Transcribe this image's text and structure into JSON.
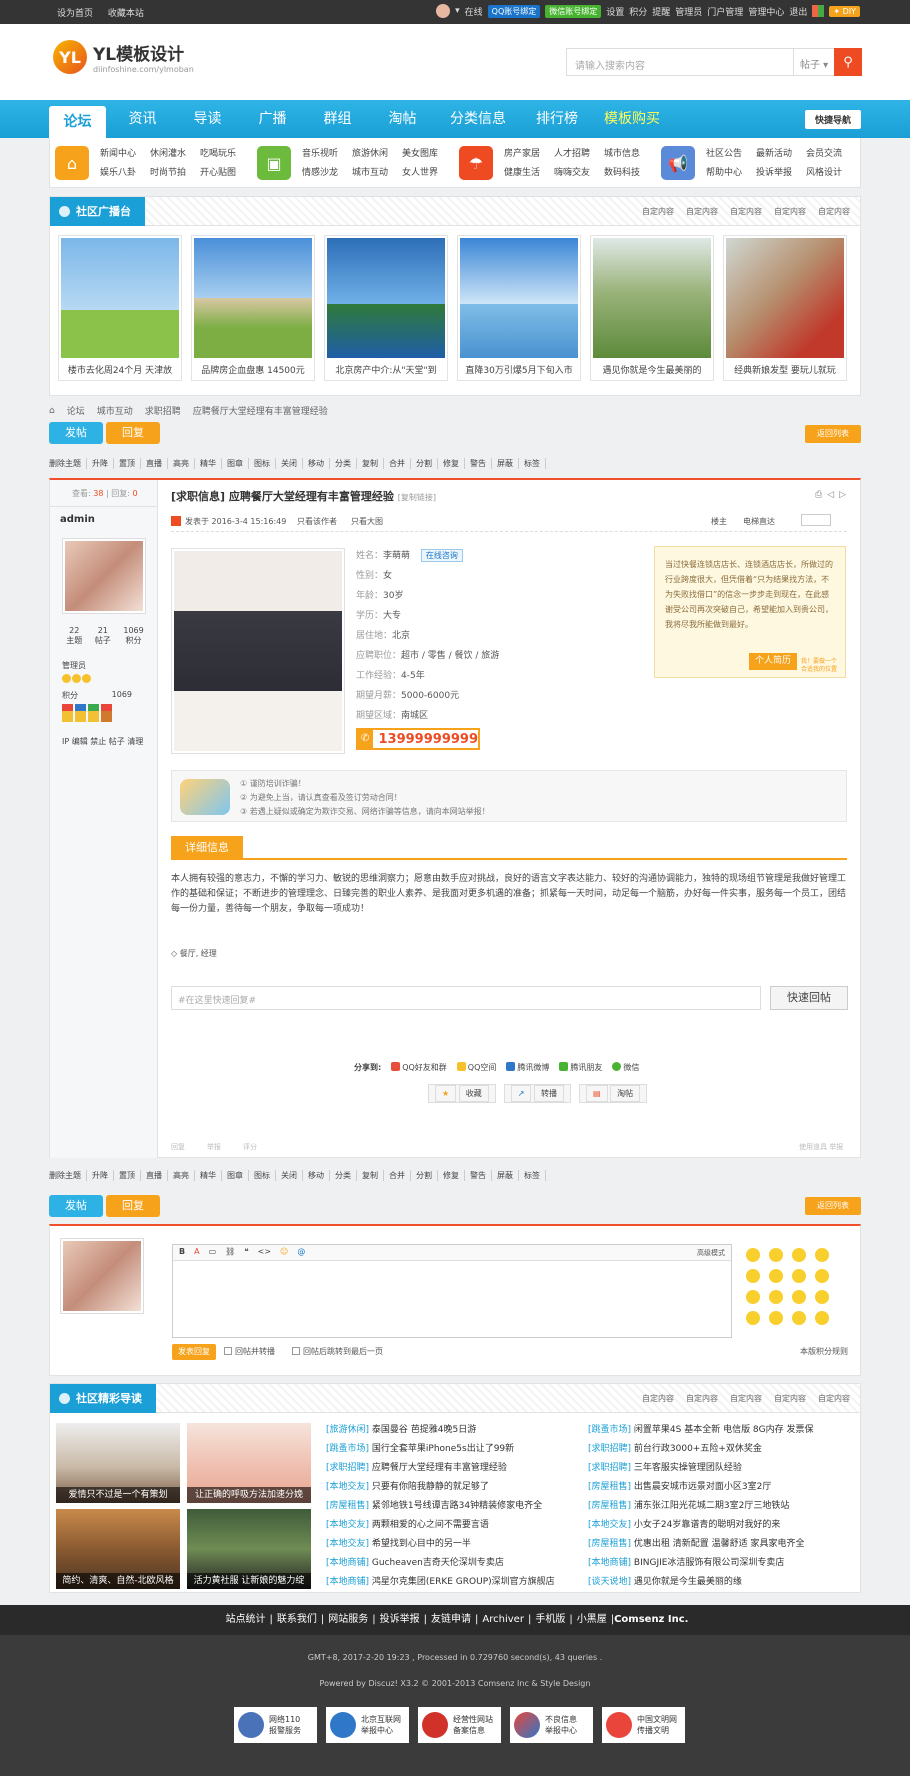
{
  "topbar": {
    "left": [
      "设为首页",
      "收藏本站"
    ],
    "online": "在线",
    "qq_bind": "QQ账号绑定",
    "wx_bind": "微信账号绑定",
    "right_links": [
      "设置",
      "积分",
      "提醒",
      "管理员",
      "门户管理",
      "管理中心",
      "退出"
    ],
    "diy": "DIY"
  },
  "header": {
    "logo_main": "YL模板设计",
    "logo_sub": "diinfoshine.com/ylmoban",
    "search_placeholder": "请输入搜索内容",
    "search_type": "帖子"
  },
  "nav": {
    "items": [
      "论坛",
      "资讯",
      "导读",
      "广播",
      "群组",
      "淘帖",
      "分类信息",
      "排行榜",
      "模板购买"
    ],
    "quick": "快捷导航"
  },
  "cats": [
    {
      "links": [
        "新闻中心",
        "休闲灌水",
        "吃喝玩乐",
        "娱乐八卦",
        "时尚节拍",
        "开心贴图"
      ],
      "color": "#f7a21b",
      "icon": "home-icon"
    },
    {
      "links": [
        "音乐视听",
        "旅游休闲",
        "美女图库",
        "情感沙龙",
        "城市互动",
        "女人世界"
      ],
      "color": "#6dbb3c",
      "icon": "picture-icon"
    },
    {
      "links": [
        "房产家居",
        "人才招聘",
        "城市信息",
        "健康生活",
        "嗨嗨交友",
        "数码科技"
      ],
      "color": "#ee4b23",
      "icon": "umbrella-icon"
    },
    {
      "links": [
        "社区公告",
        "最新活动",
        "会员交流",
        "帮助中心",
        "投诉举报",
        "风格设计"
      ],
      "color": "#5b8bd8",
      "icon": "megaphone-icon"
    }
  ],
  "broadcast": {
    "title": "社区广播台",
    "links": [
      "自定内容",
      "自定内容",
      "自定内容",
      "自定内容",
      "自定内容"
    ],
    "items": [
      "楼市去化周24个月 天津放",
      "品牌房企血盘惠 14500元",
      "北京房产中介:从\"天堂\"到",
      "直降30万引爆5月下旬入市",
      "遇见你就是今生最美丽的",
      "经典新娘发型 要玩儿就玩"
    ]
  },
  "crumb": [
    "论坛",
    "城市互动",
    "求职招聘",
    "应聘餐厅大堂经理有丰富管理经验"
  ],
  "buttons": {
    "post": "发帖",
    "reply": "回复",
    "back": "返回列表"
  },
  "modbar": [
    "删除主题",
    "升降",
    "置顶",
    "直播",
    "高亮",
    "精华",
    "图章",
    "图标",
    "关闭",
    "移动",
    "分类",
    "复制",
    "合并",
    "分割",
    "修复",
    "警告",
    "屏蔽",
    "标签"
  ],
  "post": {
    "views_label": "查看:",
    "views": "38",
    "replies_label": "回复:",
    "replies": "0",
    "author": "admin",
    "stats": [
      {
        "n": "22",
        "l": "主题"
      },
      {
        "n": "21",
        "l": "帖子"
      },
      {
        "n": "1069",
        "l": "积分"
      }
    ],
    "group": "管理员",
    "points_label": "积分",
    "points": "1069",
    "admin_links": "IP 编辑 禁止 帖子 清理",
    "title": "[求职信息] 应聘餐厅大堂经理有丰富管理经验",
    "copy": "[复制链接]",
    "meta": "发表于 2016-3-4 15:16:49",
    "only_author": "只看该作者",
    "big_img": "只看大图",
    "floor": "楼主",
    "ebook": "电梯直达",
    "fields": [
      {
        "k": "姓名：",
        "v": "李萌萌"
      },
      {
        "k": "性别：",
        "v": "女"
      },
      {
        "k": "年龄：",
        "v": "30岁"
      },
      {
        "k": "学历：",
        "v": "大专"
      },
      {
        "k": "居住地：",
        "v": "北京"
      },
      {
        "k": "应聘职位：",
        "v": "超市 / 零售 / 餐饮 / 旅游"
      },
      {
        "k": "工作经验：",
        "v": "4-5年"
      },
      {
        "k": "期望月薪：",
        "v": "5000-6000元"
      },
      {
        "k": "期望区域：",
        "v": "南城区"
      }
    ],
    "consult": "在线咨询",
    "phone": "13999999999",
    "note": "当过快餐连锁店店长、连锁酒店店长，所做过的行业跨度很大，但凭借着“只为结果找方法，不为失败找借口”的信念一步步走到现在，在此感谢受公司再次突破自己，希望能加入到贵公司，我将尽我所能做到最好。",
    "note_tag": "个人简历",
    "note_tag2": "我！要做一个合适我的位置",
    "warn": [
      "① 谨防培训诈骗！",
      "② 为避免上当，请认真查看及签订劳动合同！",
      "③ 若遇上疑似或确定为欺诈交易、网络诈骗等信息，请向本网站举报！"
    ],
    "detail_tab": "详细信息",
    "desc": "本人拥有较强的意志力，不懈的学习力、敏锐的思维洞察力；愿意由数手应对挑战，良好的语言文字表达能力、较好的沟通协调能力，独特的现场组节管理是我做好管理工作的基础和保证；不断进步的管理理念、日臻完善的职业人素养、是我面对更多机遇的准备；抓紧每一天时间，动足每一个脑筋，办好每一件实事，服务每一个员工，团结每一份力量，善待每一个朋友，争取每一项成功！",
    "tags": "餐厅, 经理",
    "reply_placeholder": "#在这里快速回复#",
    "reply_btn": "快速回帖",
    "share_label": "分享到:",
    "share": [
      "QQ好友和群",
      "QQ空间",
      "腾讯微博",
      "腾讯朋友",
      "微信"
    ],
    "actions": [
      "收藏",
      "转播",
      "淘帖"
    ],
    "bottom": [
      "回复",
      "举报",
      "评分",
      "使用道具 举报"
    ]
  },
  "quickreply": {
    "mode": "高级模式",
    "submit": "发表回复",
    "opt1": "回帖并转播",
    "opt2": "回帖后跳转到最后一页",
    "rules": "本版积分规则"
  },
  "guide": {
    "title": "社区精彩导读",
    "links": [
      "自定内容",
      "自定内容",
      "自定内容",
      "自定内容",
      "自定内容"
    ],
    "images": [
      "爱情只不过是一个有策划",
      "让正确的呼吸方法加速分娩",
      "简约、清爽、自然-北欧风格",
      "活力黄社服 让新娘的魅力绽"
    ],
    "list1": [
      {
        "c": "[旅游休闲]",
        "t": "泰国曼谷 芭提雅4晚5日游"
      },
      {
        "c": "[跳蚤市场]",
        "t": "国行全套苹果iPhone5s出让了99新"
      },
      {
        "c": "[求职招聘]",
        "t": "应聘餐厅大堂经理有丰富管理经验"
      },
      {
        "c": "[本地交友]",
        "t": "只要有你陪我静静的就足够了"
      },
      {
        "c": "[房屋租售]",
        "t": "紧邻地铁1号线谭吉路34钟精装修家电齐全"
      },
      {
        "c": "[本地交友]",
        "t": "两颗相爱的心之间不需要言语"
      },
      {
        "c": "[本地交友]",
        "t": "希望找到心目中的另一半"
      },
      {
        "c": "[本地商铺]",
        "t": "Gucheaven吉奇天伦深圳专卖店"
      },
      {
        "c": "[本地商铺]",
        "t": "鸿星尔克集团(ERKE GROUP)深圳官方旗舰店"
      }
    ],
    "list2": [
      {
        "c": "[跳蚤市场]",
        "t": "闲置苹果4S 基本全新 电信版 8G内存 发票保"
      },
      {
        "c": "[求职招聘]",
        "t": "前台行政3000+五险+双休奖金"
      },
      {
        "c": "[求职招聘]",
        "t": "三年客服实操管理团队经验"
      },
      {
        "c": "[房屋租售]",
        "t": "出售晨安城市远景对面小区3室2厅"
      },
      {
        "c": "[房屋租售]",
        "t": "浦东张江阳光花城二期3室2厅三地铁站"
      },
      {
        "c": "[本地交友]",
        "t": "小女子24岁靠谱青的聪明对我好的来"
      },
      {
        "c": "[房屋租售]",
        "t": "优惠出租 清新配置 温馨舒适 家具家电齐全"
      },
      {
        "c": "[本地商铺]",
        "t": "BINGJIE冰洁服饰有限公司深圳专卖店"
      },
      {
        "c": "[谈天说地]",
        "t": "遇见你就是今生最美丽的缘"
      }
    ]
  },
  "footer": {
    "links": [
      "站点统计",
      "联系我们",
      "网站服务",
      "投诉举报",
      "友链申请",
      "Archiver",
      "手机版",
      "小黑屋",
      "Comsenz Inc."
    ],
    "gmt": "GMT+8, 2017-2-20 19:23 , Processed in 0.729760 second(s), 43 queries .",
    "powered": "Powered by Discuz! X3.2 © 2001-2013 Comsenz Inc & Style Design",
    "badges": [
      {
        "a": "网络110",
        "b": "报警服务"
      },
      {
        "a": "北京互联网",
        "b": "举报中心"
      },
      {
        "a": "经营性网站",
        "b": "备案信息"
      },
      {
        "a": "不良信息",
        "b": "举报中心"
      },
      {
        "a": "中国文明网",
        "b": "传播文明"
      }
    ]
  }
}
